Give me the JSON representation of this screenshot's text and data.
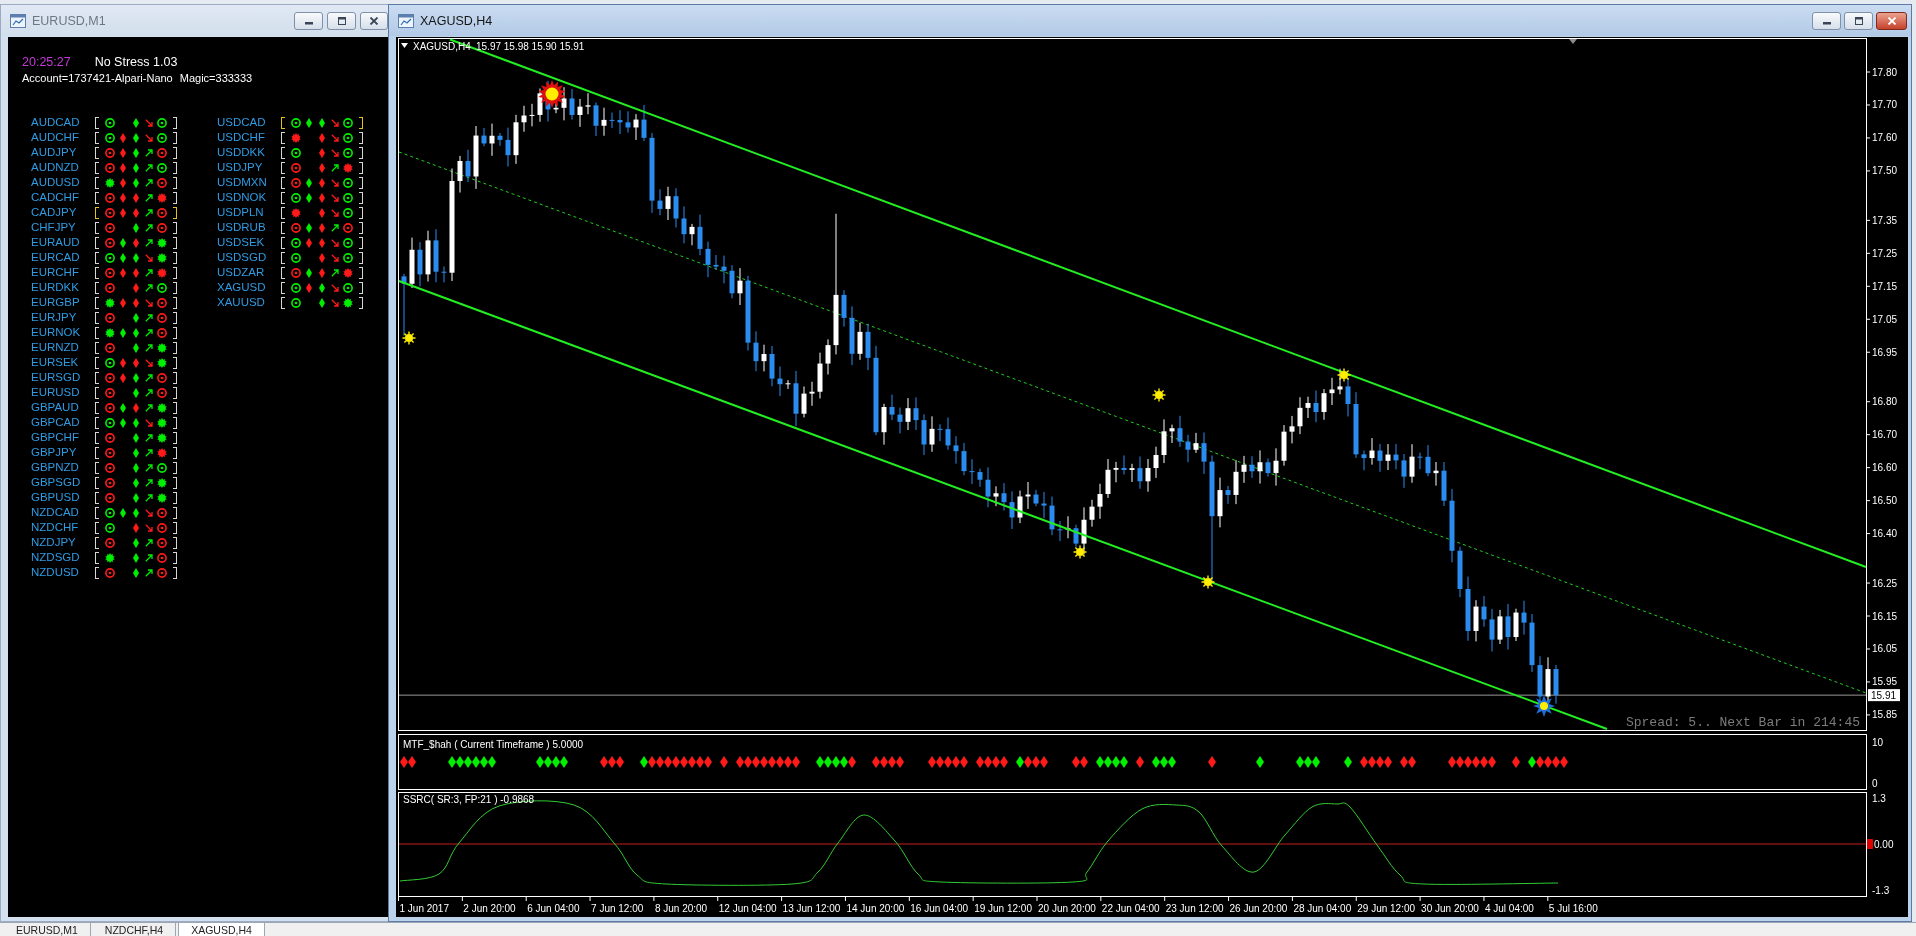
{
  "left_window": {
    "title": "EURUSD,M1",
    "active": false,
    "clock": "20:25:27",
    "ea_name": "No Stress 1.03",
    "account": "Account=1737421-Alpari-Nano",
    "magic": "Magic=333333",
    "columns": [
      {
        "rows": [
          {
            "symbol": "AUDCAD",
            "highlight": false,
            "signals": [
              {
                "kind": "ring",
                "color": "#00ee00"
              },
              {
                "kind": "blank"
              },
              {
                "kind": "diamond",
                "color": "#00ee00"
              },
              {
                "kind": "arrow-down",
                "color": "#ff1a1a"
              },
              {
                "kind": "ring",
                "color": "#00ee00"
              }
            ]
          },
          {
            "symbol": "AUDCHF",
            "highlight": false,
            "signals": [
              {
                "kind": "ring",
                "color": "#00ee00"
              },
              {
                "kind": "diamond",
                "color": "#ff1a1a"
              },
              {
                "kind": "diamond",
                "color": "#00ee00"
              },
              {
                "kind": "arrow-down",
                "color": "#ff1a1a"
              },
              {
                "kind": "ring",
                "color": "#00ee00"
              }
            ]
          },
          {
            "symbol": "AUDJPY",
            "highlight": false,
            "signals": [
              {
                "kind": "ring",
                "color": "#ff1a1a"
              },
              {
                "kind": "diamond",
                "color": "#ff1a1a"
              },
              {
                "kind": "diamond",
                "color": "#00ee00"
              },
              {
                "kind": "arrow-up",
                "color": "#00ee00"
              },
              {
                "kind": "ring",
                "color": "#ff1a1a"
              }
            ]
          },
          {
            "symbol": "AUDNZD",
            "highlight": false,
            "signals": [
              {
                "kind": "ring",
                "color": "#ff1a1a"
              },
              {
                "kind": "diamond",
                "color": "#ff1a1a"
              },
              {
                "kind": "diamond",
                "color": "#00ee00"
              },
              {
                "kind": "arrow-up",
                "color": "#00ee00"
              },
              {
                "kind": "ring",
                "color": "#00ee00"
              }
            ]
          },
          {
            "symbol": "AUDUSD",
            "highlight": false,
            "signals": [
              {
                "kind": "burst",
                "color": "#00ee00"
              },
              {
                "kind": "diamond",
                "color": "#ff1a1a"
              },
              {
                "kind": "diamond",
                "color": "#00ee00"
              },
              {
                "kind": "arrow-up",
                "color": "#00ee00"
              },
              {
                "kind": "ring",
                "color": "#ff1a1a"
              }
            ]
          },
          {
            "symbol": "CADCHF",
            "highlight": false,
            "signals": [
              {
                "kind": "ring",
                "color": "#ff1a1a"
              },
              {
                "kind": "diamond",
                "color": "#ff1a1a"
              },
              {
                "kind": "diamond",
                "color": "#ff1a1a"
              },
              {
                "kind": "arrow-up",
                "color": "#00ee00"
              },
              {
                "kind": "burst",
                "color": "#ff1a1a"
              }
            ]
          },
          {
            "symbol": "CADJPY",
            "highlight": true,
            "signals": [
              {
                "kind": "ring",
                "color": "#ff1a1a"
              },
              {
                "kind": "diamond",
                "color": "#ff1a1a"
              },
              {
                "kind": "diamond",
                "color": "#ff1a1a"
              },
              {
                "kind": "arrow-up",
                "color": "#00ee00"
              },
              {
                "kind": "ring",
                "color": "#ff1a1a"
              }
            ]
          },
          {
            "symbol": "CHFJPY",
            "highlight": false,
            "signals": [
              {
                "kind": "ring",
                "color": "#ff1a1a"
              },
              {
                "kind": "blank"
              },
              {
                "kind": "diamond",
                "color": "#00ee00"
              },
              {
                "kind": "arrow-up",
                "color": "#00ee00"
              },
              {
                "kind": "ring",
                "color": "#ff1a1a"
              }
            ]
          },
          {
            "symbol": "EURAUD",
            "highlight": false,
            "signals": [
              {
                "kind": "ring",
                "color": "#ff1a1a"
              },
              {
                "kind": "diamond",
                "color": "#00ee00"
              },
              {
                "kind": "diamond",
                "color": "#ff1a1a"
              },
              {
                "kind": "arrow-up",
                "color": "#00ee00"
              },
              {
                "kind": "burst",
                "color": "#00ee00"
              }
            ]
          },
          {
            "symbol": "EURCAD",
            "highlight": false,
            "signals": [
              {
                "kind": "ring",
                "color": "#00ee00"
              },
              {
                "kind": "diamond",
                "color": "#00ee00"
              },
              {
                "kind": "diamond",
                "color": "#00ee00"
              },
              {
                "kind": "arrow-down",
                "color": "#ff1a1a"
              },
              {
                "kind": "burst",
                "color": "#00ee00"
              }
            ]
          },
          {
            "symbol": "EURCHF",
            "highlight": false,
            "signals": [
              {
                "kind": "ring",
                "color": "#ff1a1a"
              },
              {
                "kind": "diamond",
                "color": "#ff1a1a"
              },
              {
                "kind": "diamond",
                "color": "#ff1a1a"
              },
              {
                "kind": "arrow-up",
                "color": "#00ee00"
              },
              {
                "kind": "burst",
                "color": "#ff1a1a"
              }
            ]
          },
          {
            "symbol": "EURDKK",
            "highlight": false,
            "signals": [
              {
                "kind": "ring",
                "color": "#ff1a1a"
              },
              {
                "kind": "blank"
              },
              {
                "kind": "diamond",
                "color": "#ff1a1a"
              },
              {
                "kind": "arrow-up",
                "color": "#00ee00"
              },
              {
                "kind": "ring",
                "color": "#00ee00"
              }
            ]
          },
          {
            "symbol": "EURGBP",
            "highlight": false,
            "signals": [
              {
                "kind": "burst",
                "color": "#00ee00"
              },
              {
                "kind": "diamond",
                "color": "#ff1a1a"
              },
              {
                "kind": "diamond",
                "color": "#ff1a1a"
              },
              {
                "kind": "arrow-down",
                "color": "#ff1a1a"
              },
              {
                "kind": "ring",
                "color": "#ff1a1a"
              }
            ]
          },
          {
            "symbol": "EURJPY",
            "highlight": false,
            "signals": [
              {
                "kind": "ring",
                "color": "#ff1a1a"
              },
              {
                "kind": "blank"
              },
              {
                "kind": "diamond",
                "color": "#00ee00"
              },
              {
                "kind": "arrow-up",
                "color": "#00ee00"
              },
              {
                "kind": "ring",
                "color": "#ff1a1a"
              }
            ]
          },
          {
            "symbol": "EURNOK",
            "highlight": false,
            "signals": [
              {
                "kind": "burst",
                "color": "#00ee00"
              },
              {
                "kind": "diamond",
                "color": "#00ee00"
              },
              {
                "kind": "diamond",
                "color": "#00ee00"
              },
              {
                "kind": "arrow-up",
                "color": "#00ee00"
              },
              {
                "kind": "ring",
                "color": "#ff1a1a"
              }
            ]
          },
          {
            "symbol": "EURNZD",
            "highlight": false,
            "signals": [
              {
                "kind": "ring",
                "color": "#ff1a1a"
              },
              {
                "kind": "blank"
              },
              {
                "kind": "diamond",
                "color": "#00ee00"
              },
              {
                "kind": "arrow-up",
                "color": "#00ee00"
              },
              {
                "kind": "burst",
                "color": "#00ee00"
              }
            ]
          },
          {
            "symbol": "EURSEK",
            "highlight": false,
            "signals": [
              {
                "kind": "ring",
                "color": "#00ee00"
              },
              {
                "kind": "diamond",
                "color": "#ff1a1a"
              },
              {
                "kind": "diamond",
                "color": "#ff1a1a"
              },
              {
                "kind": "arrow-down",
                "color": "#ff1a1a"
              },
              {
                "kind": "burst",
                "color": "#00ee00"
              }
            ]
          },
          {
            "symbol": "EURSGD",
            "highlight": false,
            "signals": [
              {
                "kind": "ring",
                "color": "#ff1a1a"
              },
              {
                "kind": "diamond",
                "color": "#ff1a1a"
              },
              {
                "kind": "diamond",
                "color": "#00ee00"
              },
              {
                "kind": "arrow-up",
                "color": "#00ee00"
              },
              {
                "kind": "ring",
                "color": "#ff1a1a"
              }
            ]
          },
          {
            "symbol": "EURUSD",
            "highlight": false,
            "signals": [
              {
                "kind": "ring",
                "color": "#ff1a1a"
              },
              {
                "kind": "blank"
              },
              {
                "kind": "diamond",
                "color": "#00ee00"
              },
              {
                "kind": "arrow-up",
                "color": "#00ee00"
              },
              {
                "kind": "ring",
                "color": "#ff1a1a"
              }
            ]
          },
          {
            "symbol": "GBPAUD",
            "highlight": false,
            "signals": [
              {
                "kind": "ring",
                "color": "#ff1a1a"
              },
              {
                "kind": "diamond",
                "color": "#00ee00"
              },
              {
                "kind": "diamond",
                "color": "#ff1a1a"
              },
              {
                "kind": "arrow-up",
                "color": "#00ee00"
              },
              {
                "kind": "burst",
                "color": "#00ee00"
              }
            ]
          },
          {
            "symbol": "GBPCAD",
            "highlight": false,
            "signals": [
              {
                "kind": "ring",
                "color": "#00ee00"
              },
              {
                "kind": "diamond",
                "color": "#00ee00"
              },
              {
                "kind": "diamond",
                "color": "#00ee00"
              },
              {
                "kind": "arrow-down",
                "color": "#ff1a1a"
              },
              {
                "kind": "burst",
                "color": "#00ee00"
              }
            ]
          },
          {
            "symbol": "GBPCHF",
            "highlight": false,
            "signals": [
              {
                "kind": "ring",
                "color": "#ff1a1a"
              },
              {
                "kind": "blank"
              },
              {
                "kind": "diamond",
                "color": "#00ee00"
              },
              {
                "kind": "arrow-up",
                "color": "#00ee00"
              },
              {
                "kind": "burst",
                "color": "#00ee00"
              }
            ]
          },
          {
            "symbol": "GBPJPY",
            "highlight": false,
            "signals": [
              {
                "kind": "ring",
                "color": "#ff1a1a"
              },
              {
                "kind": "blank"
              },
              {
                "kind": "diamond",
                "color": "#00ee00"
              },
              {
                "kind": "arrow-up",
                "color": "#00ee00"
              },
              {
                "kind": "burst",
                "color": "#ff1a1a"
              }
            ]
          },
          {
            "symbol": "GBPNZD",
            "highlight": false,
            "signals": [
              {
                "kind": "ring",
                "color": "#ff1a1a"
              },
              {
                "kind": "blank"
              },
              {
                "kind": "diamond",
                "color": "#00ee00"
              },
              {
                "kind": "arrow-up",
                "color": "#00ee00"
              },
              {
                "kind": "ring",
                "color": "#00ee00"
              }
            ]
          },
          {
            "symbol": "GBPSGD",
            "highlight": false,
            "signals": [
              {
                "kind": "ring",
                "color": "#ff1a1a"
              },
              {
                "kind": "blank"
              },
              {
                "kind": "diamond",
                "color": "#00ee00"
              },
              {
                "kind": "arrow-up",
                "color": "#00ee00"
              },
              {
                "kind": "burst",
                "color": "#00ee00"
              }
            ]
          },
          {
            "symbol": "GBPUSD",
            "highlight": false,
            "signals": [
              {
                "kind": "ring",
                "color": "#ff1a1a"
              },
              {
                "kind": "blank"
              },
              {
                "kind": "diamond",
                "color": "#00ee00"
              },
              {
                "kind": "arrow-up",
                "color": "#00ee00"
              },
              {
                "kind": "burst",
                "color": "#00ee00"
              }
            ]
          },
          {
            "symbol": "NZDCAD",
            "highlight": false,
            "signals": [
              {
                "kind": "ring",
                "color": "#00ee00"
              },
              {
                "kind": "diamond",
                "color": "#00ee00"
              },
              {
                "kind": "diamond",
                "color": "#00ee00"
              },
              {
                "kind": "arrow-down",
                "color": "#ff1a1a"
              },
              {
                "kind": "ring",
                "color": "#ff1a1a"
              }
            ]
          },
          {
            "symbol": "NZDCHF",
            "highlight": false,
            "signals": [
              {
                "kind": "ring",
                "color": "#00ee00"
              },
              {
                "kind": "blank"
              },
              {
                "kind": "diamond",
                "color": "#ff1a1a"
              },
              {
                "kind": "arrow-down",
                "color": "#ff1a1a"
              },
              {
                "kind": "ring",
                "color": "#ff1a1a"
              }
            ]
          },
          {
            "symbol": "NZDJPY",
            "highlight": false,
            "signals": [
              {
                "kind": "ring",
                "color": "#ff1a1a"
              },
              {
                "kind": "blank"
              },
              {
                "kind": "diamond",
                "color": "#00ee00"
              },
              {
                "kind": "arrow-up",
                "color": "#00ee00"
              },
              {
                "kind": "ring",
                "color": "#ff1a1a"
              }
            ]
          },
          {
            "symbol": "NZDSGD",
            "highlight": false,
            "signals": [
              {
                "kind": "burst",
                "color": "#00ee00"
              },
              {
                "kind": "blank"
              },
              {
                "kind": "diamond",
                "color": "#00ee00"
              },
              {
                "kind": "arrow-up",
                "color": "#00ee00"
              },
              {
                "kind": "ring",
                "color": "#ff1a1a"
              }
            ]
          },
          {
            "symbol": "NZDUSD",
            "highlight": false,
            "signals": [
              {
                "kind": "ring",
                "color": "#ff1a1a"
              },
              {
                "kind": "blank"
              },
              {
                "kind": "diamond",
                "color": "#00ee00"
              },
              {
                "kind": "arrow-up",
                "color": "#00ee00"
              },
              {
                "kind": "ring",
                "color": "#ff1a1a"
              }
            ]
          }
        ]
      },
      {
        "rows": [
          {
            "symbol": "USDCAD",
            "highlight": true,
            "signals": [
              {
                "kind": "ring",
                "color": "#00ee00"
              },
              {
                "kind": "diamond",
                "color": "#00ee00"
              },
              {
                "kind": "diamond",
                "color": "#00ee00"
              },
              {
                "kind": "arrow-down",
                "color": "#ff1a1a"
              },
              {
                "kind": "ring",
                "color": "#00ee00"
              }
            ]
          },
          {
            "symbol": "USDCHF",
            "highlight": false,
            "signals": [
              {
                "kind": "burst",
                "color": "#ff1a1a"
              },
              {
                "kind": "blank"
              },
              {
                "kind": "diamond",
                "color": "#ff1a1a"
              },
              {
                "kind": "arrow-down",
                "color": "#ff1a1a"
              },
              {
                "kind": "ring",
                "color": "#00ee00"
              }
            ]
          },
          {
            "symbol": "USDDKK",
            "highlight": false,
            "signals": [
              {
                "kind": "ring",
                "color": "#00ee00"
              },
              {
                "kind": "blank"
              },
              {
                "kind": "diamond",
                "color": "#ff1a1a"
              },
              {
                "kind": "arrow-down",
                "color": "#ff1a1a"
              },
              {
                "kind": "ring",
                "color": "#00ee00"
              }
            ]
          },
          {
            "symbol": "USDJPY",
            "highlight": false,
            "signals": [
              {
                "kind": "ring",
                "color": "#ff1a1a"
              },
              {
                "kind": "blank"
              },
              {
                "kind": "diamond",
                "color": "#ff1a1a"
              },
              {
                "kind": "arrow-up",
                "color": "#00ee00"
              },
              {
                "kind": "burst",
                "color": "#ff1a1a"
              }
            ]
          },
          {
            "symbol": "USDMXN",
            "highlight": false,
            "signals": [
              {
                "kind": "ring",
                "color": "#ff1a1a"
              },
              {
                "kind": "diamond",
                "color": "#00ee00"
              },
              {
                "kind": "diamond",
                "color": "#ff1a1a"
              },
              {
                "kind": "arrow-down",
                "color": "#ff1a1a"
              },
              {
                "kind": "ring",
                "color": "#00ee00"
              }
            ]
          },
          {
            "symbol": "USDNOK",
            "highlight": false,
            "signals": [
              {
                "kind": "ring",
                "color": "#00ee00"
              },
              {
                "kind": "diamond",
                "color": "#00ee00"
              },
              {
                "kind": "diamond",
                "color": "#ff1a1a"
              },
              {
                "kind": "arrow-down",
                "color": "#ff1a1a"
              },
              {
                "kind": "ring",
                "color": "#00ee00"
              }
            ]
          },
          {
            "symbol": "USDPLN",
            "highlight": false,
            "signals": [
              {
                "kind": "burst",
                "color": "#ff1a1a"
              },
              {
                "kind": "blank"
              },
              {
                "kind": "diamond",
                "color": "#ff1a1a"
              },
              {
                "kind": "arrow-down",
                "color": "#ff1a1a"
              },
              {
                "kind": "ring",
                "color": "#00ee00"
              }
            ]
          },
          {
            "symbol": "USDRUB",
            "highlight": false,
            "signals": [
              {
                "kind": "ring",
                "color": "#ff1a1a"
              },
              {
                "kind": "diamond",
                "color": "#00ee00"
              },
              {
                "kind": "diamond",
                "color": "#ff1a1a"
              },
              {
                "kind": "arrow-up",
                "color": "#00ee00"
              },
              {
                "kind": "ring",
                "color": "#ff1a1a"
              }
            ]
          },
          {
            "symbol": "USDSEK",
            "highlight": false,
            "signals": [
              {
                "kind": "ring",
                "color": "#00ee00"
              },
              {
                "kind": "diamond",
                "color": "#ff1a1a"
              },
              {
                "kind": "diamond",
                "color": "#ff1a1a"
              },
              {
                "kind": "arrow-down",
                "color": "#ff1a1a"
              },
              {
                "kind": "ring",
                "color": "#00ee00"
              }
            ]
          },
          {
            "symbol": "USDSGD",
            "highlight": false,
            "signals": [
              {
                "kind": "ring",
                "color": "#00ee00"
              },
              {
                "kind": "blank"
              },
              {
                "kind": "diamond",
                "color": "#ff1a1a"
              },
              {
                "kind": "arrow-down",
                "color": "#ff1a1a"
              },
              {
                "kind": "ring",
                "color": "#00ee00"
              }
            ]
          },
          {
            "symbol": "USDZAR",
            "highlight": false,
            "signals": [
              {
                "kind": "ring",
                "color": "#ff1a1a"
              },
              {
                "kind": "diamond",
                "color": "#00ee00"
              },
              {
                "kind": "diamond",
                "color": "#ff1a1a"
              },
              {
                "kind": "arrow-up",
                "color": "#00ee00"
              },
              {
                "kind": "burst",
                "color": "#ff1a1a"
              }
            ]
          },
          {
            "symbol": "XAGUSD",
            "highlight": false,
            "signals": [
              {
                "kind": "ring",
                "color": "#00ee00"
              },
              {
                "kind": "diamond",
                "color": "#ff1a1a"
              },
              {
                "kind": "diamond",
                "color": "#00ee00"
              },
              {
                "kind": "arrow-down",
                "color": "#ff1a1a"
              },
              {
                "kind": "ring",
                "color": "#00ee00"
              }
            ]
          },
          {
            "symbol": "XAUUSD",
            "highlight": false,
            "signals": [
              {
                "kind": "ring",
                "color": "#00ee00"
              },
              {
                "kind": "blank"
              },
              {
                "kind": "diamond",
                "color": "#00ee00"
              },
              {
                "kind": "arrow-down",
                "color": "#ff1a1a"
              },
              {
                "kind": "burst",
                "color": "#00ee00"
              }
            ]
          }
        ]
      }
    ]
  },
  "chart_window": {
    "title": "XAGUSD,H4",
    "active": true,
    "header": {
      "symbol": "XAGUSD,H4",
      "ohlc": "15.97 15.98 15.90 15.91"
    },
    "price_axis": [
      "17.80",
      "17.70",
      "17.60",
      "17.50",
      "17.35",
      "17.25",
      "17.15",
      "17.05",
      "16.95",
      "16.80",
      "16.70",
      "16.60",
      "16.50",
      "16.40",
      "16.25",
      "16.15",
      "16.05",
      "15.95",
      "15.85"
    ],
    "current_price": "15.91",
    "info": "Spread: 5.. Next Bar in 214:45",
    "indicators": [
      {
        "title": "MTF_$hah ( Current Timeframe ) 5.0000",
        "kind": "markers",
        "axis": [
          {
            "text": "10",
            "kind": "tick"
          },
          {
            "text": "0",
            "kind": "tick"
          }
        ]
      },
      {
        "title": "SSRC( SR:3, FP:21 ) -0.9868",
        "kind": "oscillator",
        "axis": [
          {
            "text": "1.3",
            "kind": "tick"
          },
          {
            "text": "0.00",
            "kind": "level"
          },
          {
            "text": "-1.3",
            "kind": "tick"
          }
        ]
      }
    ],
    "time_axis": [
      "1 Jun 2017",
      "2 Jun 20:00",
      "6 Jun 04:00",
      "7 Jun 12:00",
      "8 Jun 20:00",
      "12 Jun 04:00",
      "13 Jun 12:00",
      "14 Jun 20:00",
      "16 Jun 04:00",
      "19 Jun 12:00",
      "20 Jun 20:00",
      "22 Jun 04:00",
      "23 Jun 12:00",
      "26 Jun 20:00",
      "28 Jun 04:00",
      "29 Jun 12:00",
      "30 Jun 20:00",
      "4 Jul 04:00",
      "5 Jul 16:00"
    ]
  },
  "tabs": [
    {
      "label": "EURUSD,M1",
      "selected": false
    },
    {
      "label": "NZDCHF,H4",
      "selected": false
    },
    {
      "label": "XAGUSD,H4",
      "selected": true
    }
  ]
}
